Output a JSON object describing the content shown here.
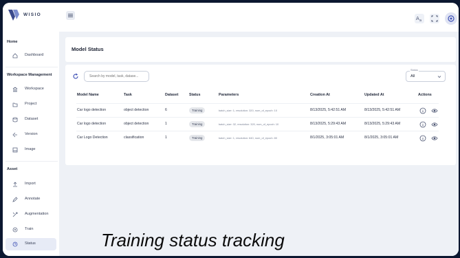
{
  "app": {
    "brand": "WISIO",
    "accent": "#3f51b5",
    "icons": [
      "menu-icon",
      "translate-icon",
      "fullscreen-icon",
      "settings-icon"
    ]
  },
  "sidebar": {
    "sections": [
      {
        "title": "Home",
        "items": [
          {
            "label": "Dashboard",
            "icon": "home-icon"
          }
        ]
      },
      {
        "title": "Workspace Management",
        "items": [
          {
            "label": "Workspace",
            "icon": "building-icon"
          },
          {
            "label": "Project",
            "icon": "folder-icon"
          },
          {
            "label": "Dataset",
            "icon": "database-icon"
          },
          {
            "label": "Version",
            "icon": "version-icon"
          },
          {
            "label": "Image",
            "icon": "image-icon"
          }
        ]
      },
      {
        "title": "Asset",
        "items": [
          {
            "label": "Import",
            "icon": "upload-icon"
          },
          {
            "label": "Annotate",
            "icon": "pencil-icon"
          },
          {
            "label": "Augmentation",
            "icon": "augment-icon"
          },
          {
            "label": "Train",
            "icon": "train-icon"
          },
          {
            "label": "Status",
            "icon": "status-icon",
            "active": true
          }
        ]
      }
    ]
  },
  "page": {
    "title": "Model Status",
    "search_placeholder": "Search by model, task, datase...",
    "status_filter": {
      "label": "Status",
      "value": "All"
    }
  },
  "table": {
    "columns": [
      "Model Name",
      "Task",
      "Dataset",
      "Status",
      "Parameters",
      "Creation At",
      "Updated At",
      "Actions"
    ],
    "rows": [
      {
        "model_name": "Car logo detection",
        "task": "object detection",
        "dataset": "6",
        "status": "Training",
        "parameters": "batch_size: 1, resolution: 320, num_of_epoch: 10",
        "created": "8/13/2025, 5:42:51 AM",
        "updated": "8/13/2025, 5:42:51 AM"
      },
      {
        "model_name": "Car logo detection",
        "task": "object detection",
        "dataset": "1",
        "status": "Training",
        "parameters": "batch_size: 32, resolution: 320, num_of_epoch: 10",
        "created": "8/13/2025, 5:29:43 AM",
        "updated": "8/13/2025, 5:29:43 AM"
      },
      {
        "model_name": "Car Logo Detection",
        "task": "classification",
        "dataset": "1",
        "status": "Training",
        "parameters": "batch_size: 1, resolution: 640, num_of_epoch: 80",
        "created": "8/1/2025, 3:05:01 AM",
        "updated": "8/1/2025, 3:05:01 AM"
      }
    ]
  },
  "caption": "Training status tracking"
}
